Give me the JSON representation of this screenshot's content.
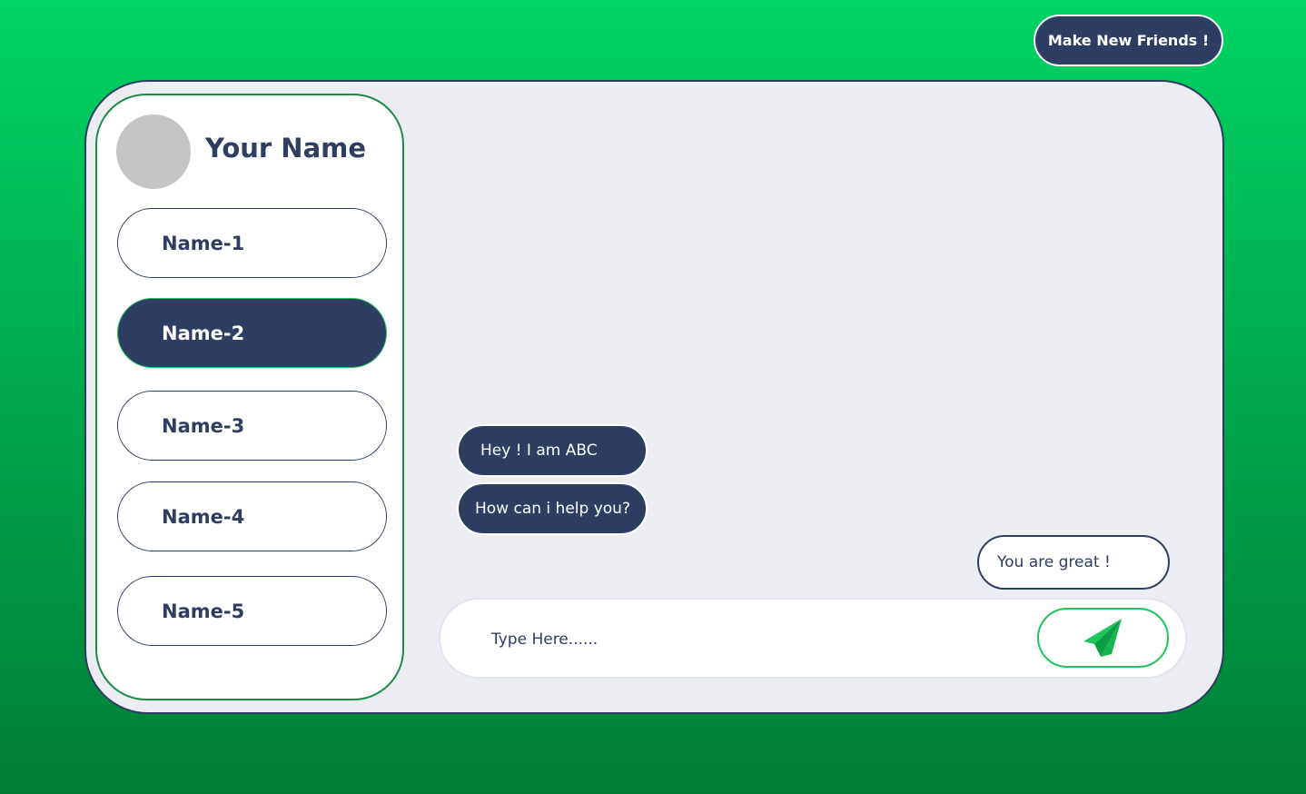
{
  "header": {
    "make_friends_label": "Make New Friends !"
  },
  "profile": {
    "name": "Your Name"
  },
  "contacts": [
    {
      "label": "Name-1",
      "active": false
    },
    {
      "label": "Name-2",
      "active": true
    },
    {
      "label": "Name-3",
      "active": false
    },
    {
      "label": "Name-4",
      "active": false
    },
    {
      "label": "Name-5",
      "active": false
    }
  ],
  "messages": {
    "incoming": [
      "Hey ! I am ABC",
      "How can i help you?"
    ],
    "outgoing": [
      "You are great !"
    ]
  },
  "composer": {
    "placeholder": "Type Here......",
    "send_icon": "paper-plane-icon"
  },
  "colors": {
    "navy": "#2e3e62",
    "green": "#1fc45c",
    "background_top": "#00d463",
    "background_bottom": "#007e36"
  }
}
